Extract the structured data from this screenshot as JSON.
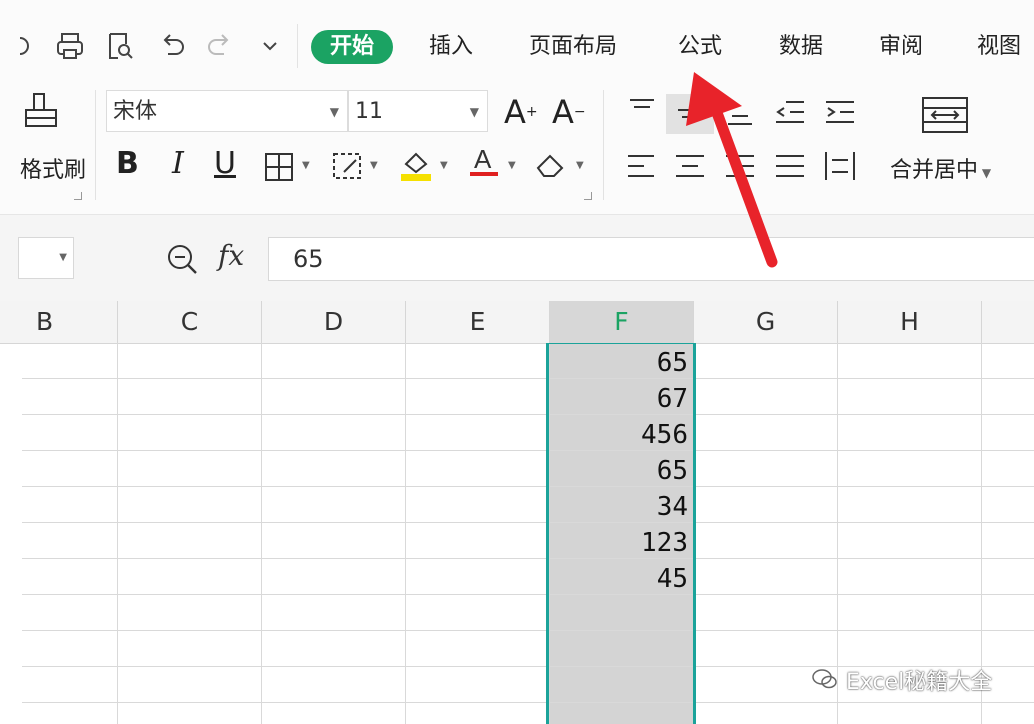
{
  "menu": {
    "tabs": [
      {
        "label": "开始",
        "active": true
      },
      {
        "label": "插入"
      },
      {
        "label": "页面布局"
      },
      {
        "label": "公式"
      },
      {
        "label": "数据"
      },
      {
        "label": "审阅"
      },
      {
        "label": "视图"
      }
    ],
    "quick_access_icons": [
      "redo-icon",
      "print-icon",
      "print-preview-icon",
      "undo-icon",
      "redo-disabled-icon",
      "customize-dropdown-icon"
    ]
  },
  "ribbon": {
    "format_painter_label": "格式刷",
    "font_name": "宋体",
    "font_size": "11",
    "merge_center_label": "合并居中",
    "font_color": "#e02020",
    "highlight_color": "#f5e000"
  },
  "formula_bar": {
    "zoom_icon": "zoom-icon",
    "fx_label": "fx",
    "value": "65"
  },
  "sheet": {
    "columns": [
      "B",
      "C",
      "D",
      "E",
      "F",
      "G",
      "H"
    ],
    "selected_column": "F",
    "f_values": [
      "65",
      "67",
      "456",
      "65",
      "34",
      "123",
      "45"
    ]
  },
  "watermark": {
    "text": "Excel秘籍大全"
  },
  "colors": {
    "accent": "#1ba363",
    "selection_border": "#1ba39a",
    "arrow": "#e8232a"
  }
}
